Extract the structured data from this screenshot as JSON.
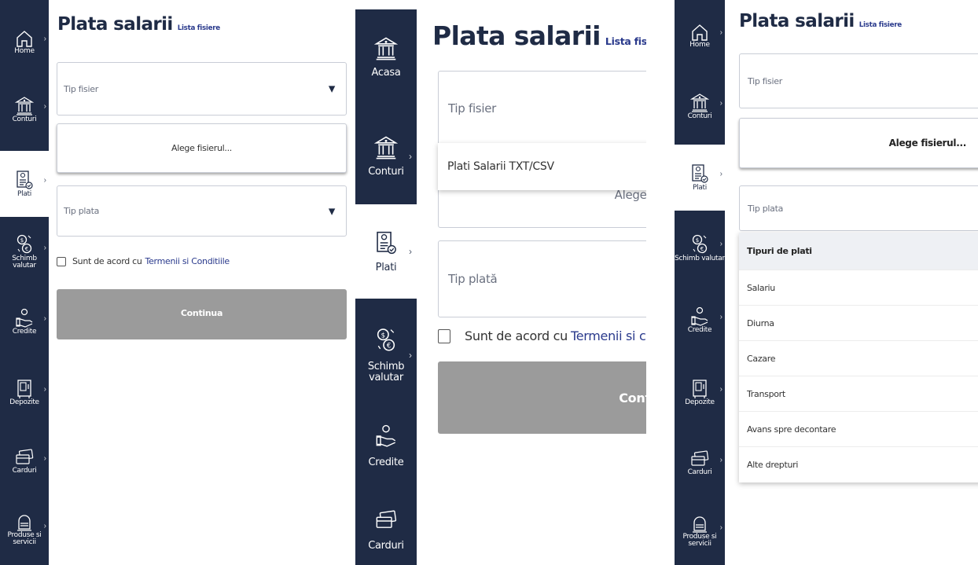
{
  "panel1": {
    "nav": [
      {
        "label": "Home",
        "icon": "home-icon"
      },
      {
        "label": "Conturi",
        "icon": "bank-icon"
      },
      {
        "label": "Plati",
        "icon": "payment-doc-icon",
        "active": true
      },
      {
        "label": "Schimb valutar",
        "icon": "exchange-icon"
      },
      {
        "label": "Credite",
        "icon": "credit-hand-icon"
      },
      {
        "label": "Depozite",
        "icon": "deposit-safe-icon"
      },
      {
        "label": "Carduri",
        "icon": "cards-icon"
      },
      {
        "label": "Produse si servicii",
        "icon": "products-icon"
      }
    ],
    "title": "Plata salarii",
    "title_link": "Lista fisiere",
    "tip_fisier": "Tip fisier",
    "file_button": "Alege fisierul...",
    "tip_plata": "Tip plata",
    "terms_prefix": "Sunt de acord cu",
    "terms_link": "Termenii si Conditiile",
    "continue": "Continua"
  },
  "panel2": {
    "nav": [
      {
        "label": "Acasa",
        "icon": "bank-icon"
      },
      {
        "label": "Conturi",
        "icon": "bank-icon"
      },
      {
        "label": "Plati",
        "icon": "payment-doc-icon",
        "active": true
      },
      {
        "label": "Schimb valutar",
        "icon": "exchange-icon"
      },
      {
        "label": "Credite",
        "icon": "credit-hand-icon"
      },
      {
        "label": "Carduri",
        "icon": "cards-icon"
      }
    ],
    "title": "Plata salarii",
    "title_link": "Lista fisiere salari",
    "tip_fisier": "Tip fisier",
    "dropdown_option": "Plati Salarii TXT/CSV",
    "file_button_partial": "Alege f",
    "tip_plata": "Tip plată",
    "terms_prefix": "Sunt de acord cu",
    "terms_link": "Termenii si conditii",
    "continue_partial": "Conti"
  },
  "panel3": {
    "nav": [
      {
        "label": "Home",
        "icon": "home-icon"
      },
      {
        "label": "Conturi",
        "icon": "bank-icon"
      },
      {
        "label": "Plati",
        "icon": "payment-doc-icon",
        "active": true
      },
      {
        "label": "Schimb valutar",
        "icon": "exchange-icon"
      },
      {
        "label": "Credite",
        "icon": "credit-hand-icon"
      },
      {
        "label": "Depozite",
        "icon": "deposit-safe-icon"
      },
      {
        "label": "Carduri",
        "icon": "cards-icon"
      },
      {
        "label": "Produse si servicii",
        "icon": "products-icon"
      }
    ],
    "title": "Plata salarii",
    "title_link": "Lista fisiere",
    "tip_fisier": "Tip fisier",
    "file_button": "Alege fisierul...",
    "tip_plata": "Tip plata",
    "dropdown_header": "Tipuri de plati",
    "dropdown_items": [
      "Salariu",
      "Diurna",
      "Cazare",
      "Transport",
      "Avans spre decontare",
      "Alte drepturi"
    ]
  },
  "colors": {
    "sidebar": "#1f2b45",
    "link": "#2a3a8c",
    "disabled_button": "#9b9b9b"
  }
}
